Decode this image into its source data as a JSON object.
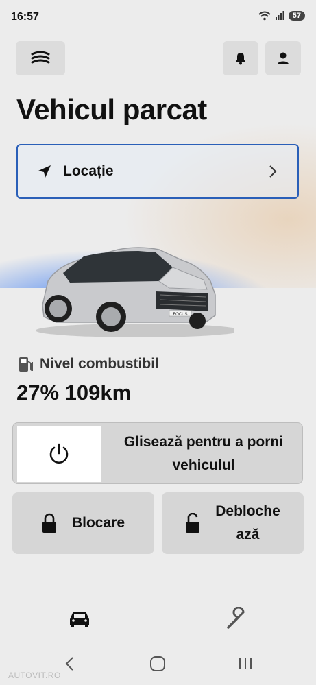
{
  "status_bar": {
    "time": "16:57",
    "battery": "57"
  },
  "header": {
    "title": "Vehicul parcat",
    "menu_icon": "stack-icon",
    "notification_icon": "bell-icon",
    "profile_icon": "user-icon"
  },
  "location": {
    "label": "Locație",
    "icon": "navigation-arrow-icon",
    "chevron": "chevron-right-icon"
  },
  "vehicle": {
    "badge": "FOCUS"
  },
  "fuel": {
    "label": "Nivel combustibil",
    "value": "27% 109km",
    "icon": "fuel-pump-icon"
  },
  "start_slider": {
    "label": "Glisează pentru a porni vehiculul",
    "icon": "power-icon"
  },
  "actions": {
    "lock_label": "Blocare",
    "unlock_label_line1": "Debloche",
    "unlock_label_line2": "ază"
  },
  "tabs": [
    {
      "icon": "car-icon",
      "active": true
    },
    {
      "icon": "wrench-icon",
      "active": false
    }
  ],
  "watermark": "AUTOVIT.RO",
  "colors": {
    "accent_border": "#2a5fb8",
    "button_bg": "#d6d6d6",
    "page_bg": "#ececec"
  }
}
